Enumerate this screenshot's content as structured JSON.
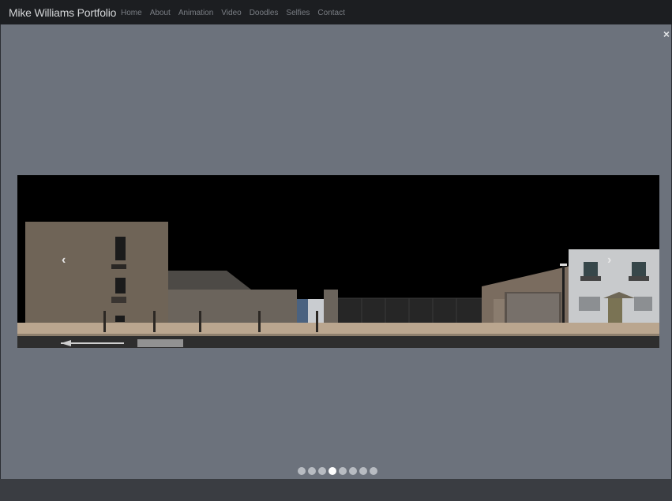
{
  "brand": "Mike Williams Portfolio",
  "nav": [
    "Home",
    "About",
    "Animation",
    "Video",
    "Doodles",
    "Selfies",
    "Contact"
  ],
  "lightbox": {
    "close_label": "×",
    "prev_label": "‹",
    "next_label": "›",
    "slide_count": 8,
    "active_index": 3
  },
  "colors": {
    "navbar_bg": "#1c1e21",
    "overlay_bg": "#6c727c",
    "indicator_active": "#ffffff",
    "indicator_inactive": "#b8bcc2"
  }
}
